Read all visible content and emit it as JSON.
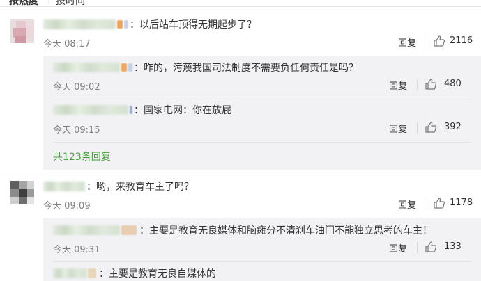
{
  "sort": {
    "hot": "按热度",
    "sep": "|",
    "time": "按时间"
  },
  "comments": [
    {
      "text": "：以后站车顶得无期起步了？",
      "time": "今天 08:17",
      "reply": "回复",
      "likes": "2116",
      "replies": [
        {
          "text": "：咋的，污蔑我国司法制度不需要负任何责任是吗？",
          "time": "今天 09:02",
          "reply": "回复",
          "likes": "480"
        },
        {
          "text": "：国家电网：你在放屁",
          "time": "今天 09:15",
          "reply": "回复",
          "likes": "392"
        }
      ],
      "more": "共123条回复"
    },
    {
      "text": "：哟，来教育车主了吗？",
      "time": "今天 09:09",
      "reply": "回复",
      "likes": "1178",
      "replies": [
        {
          "text": "：主要是教育无良媒体和脑瘫分不清刹车油门不能独立思考的车主！",
          "time": "今天 09:31",
          "reply": "回复",
          "likes": "133"
        },
        {
          "text": "：主要是教育无良自媒体的"
        }
      ]
    }
  ],
  "colors": {
    "accent": "#46a23a",
    "reply_bg": "#f2f2f5",
    "meta": "#808080"
  },
  "icons": {
    "like": "thumbs-up-icon"
  }
}
